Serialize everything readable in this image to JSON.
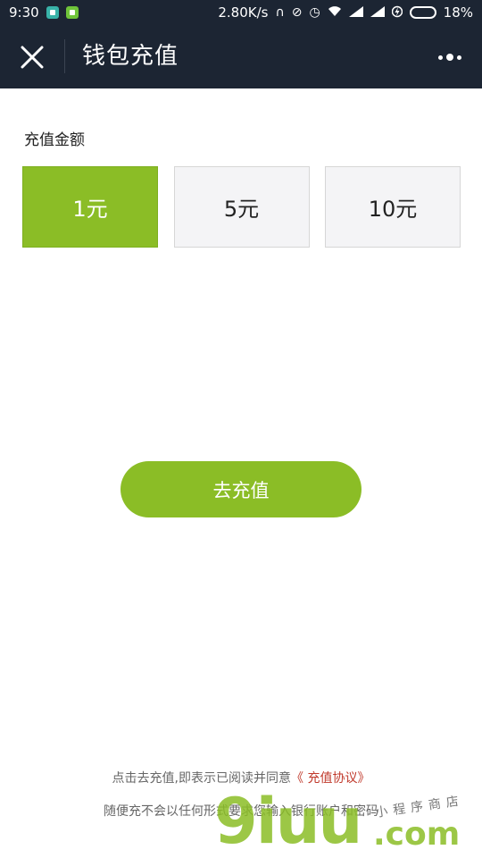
{
  "status_bar": {
    "time": "9:30",
    "network_speed": "2.80K/s",
    "battery_percent_label": "18%",
    "battery_level": 0.18,
    "icons": [
      "shield-app-icon",
      "phone-app-icon",
      "headphones-icon",
      "mute-icon",
      "alarm-icon",
      "wifi-icon",
      "signal-icon",
      "signal-icon",
      "charging-icon",
      "battery-icon"
    ]
  },
  "header": {
    "title": "钱包充值",
    "close_icon": "close-icon",
    "more_icon": "more-dots-icon"
  },
  "recharge": {
    "section_label": "充值金额",
    "amounts": [
      {
        "label": "1元",
        "selected": true
      },
      {
        "label": "5元",
        "selected": false
      },
      {
        "label": "10元",
        "selected": false
      }
    ],
    "submit_label": "去充值"
  },
  "footer": {
    "agreement_prefix": "点击去充值,即表示已阅读并同意",
    "agreement_link": "《 充值协议》",
    "safety_notice": "随便充不会以任何形式要求您输入银行账户和密码"
  },
  "watermark": {
    "main": "9iuu",
    "suffix": ".com",
    "subtext": "小程序商店"
  },
  "colors": {
    "header_bg": "#1c2533",
    "accent_green": "#8bbd26",
    "link_red": "#c0392b"
  }
}
